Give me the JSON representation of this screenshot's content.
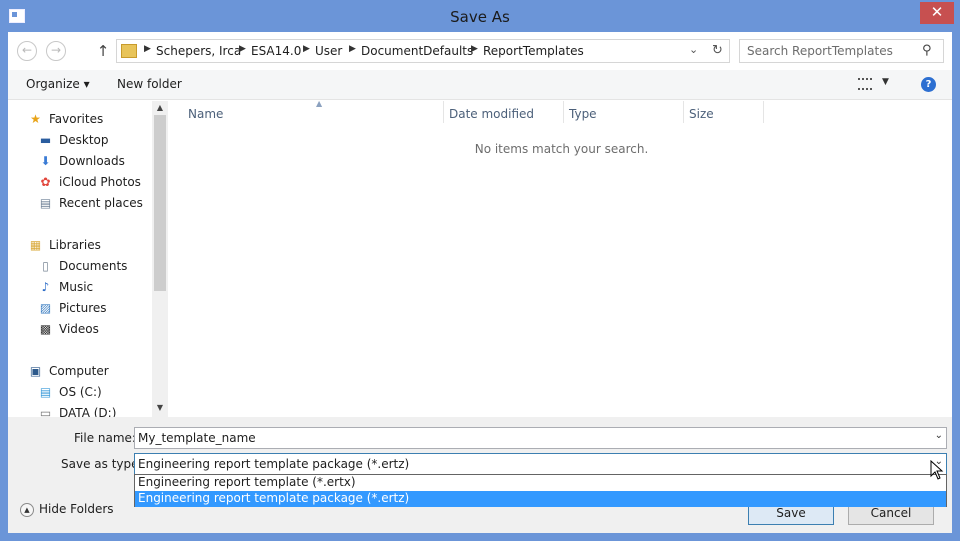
{
  "window": {
    "title": "Save As",
    "close_glyph": "✕"
  },
  "nav": {
    "back_glyph": "←",
    "forward_glyph": "→",
    "up_glyph": "↑",
    "breadcrumb": [
      "Schepers, Irca",
      "ESA14.0",
      "User",
      "DocumentDefaults",
      "ReportTemplates"
    ],
    "separator": "▶",
    "dropdown_glyph": "⌄",
    "refresh_glyph": "↻",
    "search_placeholder": "Search ReportTemplates",
    "search_glyph": "⚲"
  },
  "toolbar": {
    "organize": "Organize ▾",
    "new_folder": "New folder",
    "view_drop": "▼",
    "help": "?"
  },
  "sidebar": {
    "groups": [
      {
        "label": "Favorites",
        "icon": "star-icon",
        "glyph": "★",
        "color": "#e8a317",
        "items": [
          {
            "label": "Desktop",
            "icon": "desktop-icon",
            "glyph": "▬",
            "color": "#2a5d9f"
          },
          {
            "label": "Downloads",
            "icon": "downloads-icon",
            "glyph": "⬇",
            "color": "#3a7bd5"
          },
          {
            "label": "iCloud Photos",
            "icon": "icloud-photos-icon",
            "glyph": "✿",
            "color": "#e2463c"
          },
          {
            "label": "Recent places",
            "icon": "recent-places-icon",
            "glyph": "▤",
            "color": "#6d7f95"
          }
        ]
      },
      {
        "label": "Libraries",
        "icon": "libraries-icon",
        "glyph": "▦",
        "color": "#d9a93a",
        "items": [
          {
            "label": "Documents",
            "icon": "documents-icon",
            "glyph": "▯",
            "color": "#7a8796"
          },
          {
            "label": "Music",
            "icon": "music-icon",
            "glyph": "♪",
            "color": "#2a6bc7"
          },
          {
            "label": "Pictures",
            "icon": "pictures-icon",
            "glyph": "▨",
            "color": "#3b7ec2"
          },
          {
            "label": "Videos",
            "icon": "videos-icon",
            "glyph": "▩",
            "color": "#333333"
          }
        ]
      },
      {
        "label": "Computer",
        "icon": "computer-icon",
        "glyph": "▣",
        "color": "#2d5a8c",
        "items": [
          {
            "label": "OS (C:)",
            "icon": "drive-c-icon",
            "glyph": "▤",
            "color": "#3a9ad9"
          },
          {
            "label": "DATA (D:)",
            "icon": "drive-d-icon",
            "glyph": "▭",
            "color": "#777777"
          }
        ]
      }
    ],
    "scroll_up": "▲",
    "scroll_down": "▼"
  },
  "columns": [
    "Name",
    "Date modified",
    "Type",
    "Size"
  ],
  "sort_glyph": "▲",
  "empty_message": "No items match your search.",
  "form": {
    "file_name_label": "File name:",
    "file_name_value": "My_template_name",
    "save_type_label": "Save as type:",
    "save_type_value": "Engineering report template package (*.ertz)",
    "dropdown_glyph": "⌄",
    "type_options": [
      "Engineering report template (*.ertx)",
      "Engineering report template package (*.ertz)"
    ],
    "selected_option": 1
  },
  "buttons": {
    "hide_folders": "Hide Folders",
    "hide_glyph": "▲",
    "save": "Save",
    "cancel": "Cancel"
  }
}
